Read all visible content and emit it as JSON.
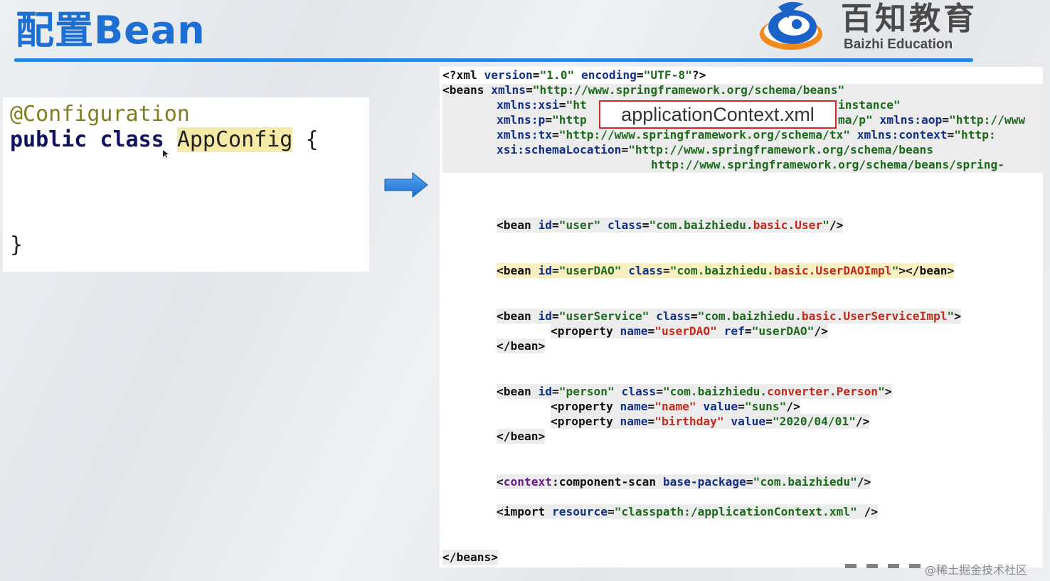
{
  "header": {
    "title": "配置Bean",
    "logo_cn": "百知教育",
    "logo_en": "Baizhi Education",
    "accent": "#1e6fd4"
  },
  "java_code": {
    "annotation": "@Configuration",
    "kw_public": "public",
    "kw_class": "class",
    "class_name": "AppConfig",
    "open_brace": "{",
    "close_brace": "}"
  },
  "file_label": "applicationContext.xml",
  "xml": {
    "decl": {
      "open": "<?xml ",
      "a1": "version",
      "eq1": "=",
      "v1": "\"1.0\"",
      "a2": " encoding",
      "eq2": "=",
      "v2": "\"UTF-8\"",
      "close": "?>"
    },
    "beans_open": {
      "tag": "<beans ",
      "a": "xmlns",
      "eq": "=",
      "v": "\"http://www.springframework.org/schema/beans\""
    },
    "xsi": {
      "a": "xmlns:xsi",
      "eq": "=",
      "v": "\"ht",
      "tail": "instance\""
    },
    "p": {
      "a": "xmlns:p",
      "eq": "=",
      "v": "\"http",
      "tail": "ma/p\"",
      "a2": " xmlns:aop",
      "eq2": "=",
      "v2": "\"http://www"
    },
    "tx": {
      "a": "xmlns:tx",
      "eq": "=",
      "v": "\"http://www.springframework.org/schema/tx\"",
      "a2": " xmlns:context",
      "eq2": "=",
      "v2": "\"http:"
    },
    "schema": {
      "a": "xsi:schemaLocation",
      "eq": "=",
      "v": "\"http://www.springframework.org/schema/beans"
    },
    "schema2": {
      "v": "http://www.springframework.org/schema/beans/spring-"
    },
    "bean_user": {
      "tag": "<bean ",
      "a1": "id",
      "eq1": "=",
      "v1": "\"user\"",
      "a2": " class",
      "eq2": "=",
      "v2a": "\"com.baizhiedu.",
      "v2b": "basic.User",
      "v2c": "\"",
      "close": "/>"
    },
    "bean_dao": {
      "tag": "<bean ",
      "a1": "id",
      "eq1": "=",
      "v1": "\"userDAO\"",
      "a2": " class",
      "eq2": "=",
      "v2a": "\"com.baizhiedu.",
      "v2b": "basic.UserDAOImpl",
      "v2c": "\"",
      "close": "></bean>"
    },
    "bean_service": {
      "tag": "<bean ",
      "a1": "id",
      "eq1": "=",
      "v1": "\"userService\"",
      "a2": " class",
      "eq2": "=",
      "v2a": "\"com.baizhiedu.",
      "v2b": "basic.UserServiceImpl",
      "v2c": "\"",
      "close": ">"
    },
    "service_prop": {
      "tag": "<property ",
      "a1": "name",
      "eq1": "=",
      "v1": "\"userDAO\"",
      "a2": " ref",
      "eq2": "=",
      "v2": "\"userDAO\"",
      "close": "/>"
    },
    "bean_end": "</bean>",
    "bean_person": {
      "tag": "<bean ",
      "a1": "id",
      "eq1": "=",
      "v1": "\"person\"",
      "a2": " class",
      "eq2": "=",
      "v2a": "\"com.baizhiedu.",
      "v2b": "converter.Person",
      "v2c": "\"",
      "close": ">"
    },
    "person_prop1": {
      "tag": "<property ",
      "a1": "name",
      "eq1": "=",
      "v1": "\"name\"",
      "a2": " value",
      "eq2": "=",
      "v2": "\"suns\"",
      "close": "/>"
    },
    "person_prop2": {
      "tag": "<property ",
      "a1": "name",
      "eq1": "=",
      "v1": "\"birthday\"",
      "a2": " value",
      "eq2": "=",
      "v2": "\"2020/04/01\"",
      "close": "/>"
    },
    "scan": {
      "lt": "<",
      "ns": "context",
      "tag": ":component-scan ",
      "a": "base-package",
      "eq": "=",
      "v": "\"com.baizhiedu\"",
      "close": "/>"
    },
    "import": {
      "tag": "<import ",
      "a": "resource",
      "eq": "=",
      "v": "\"classpath:/applicationContext.xml\"",
      "close": " />"
    },
    "beans_close": "</beans>"
  },
  "watermark": "@稀土掘金技术社区"
}
